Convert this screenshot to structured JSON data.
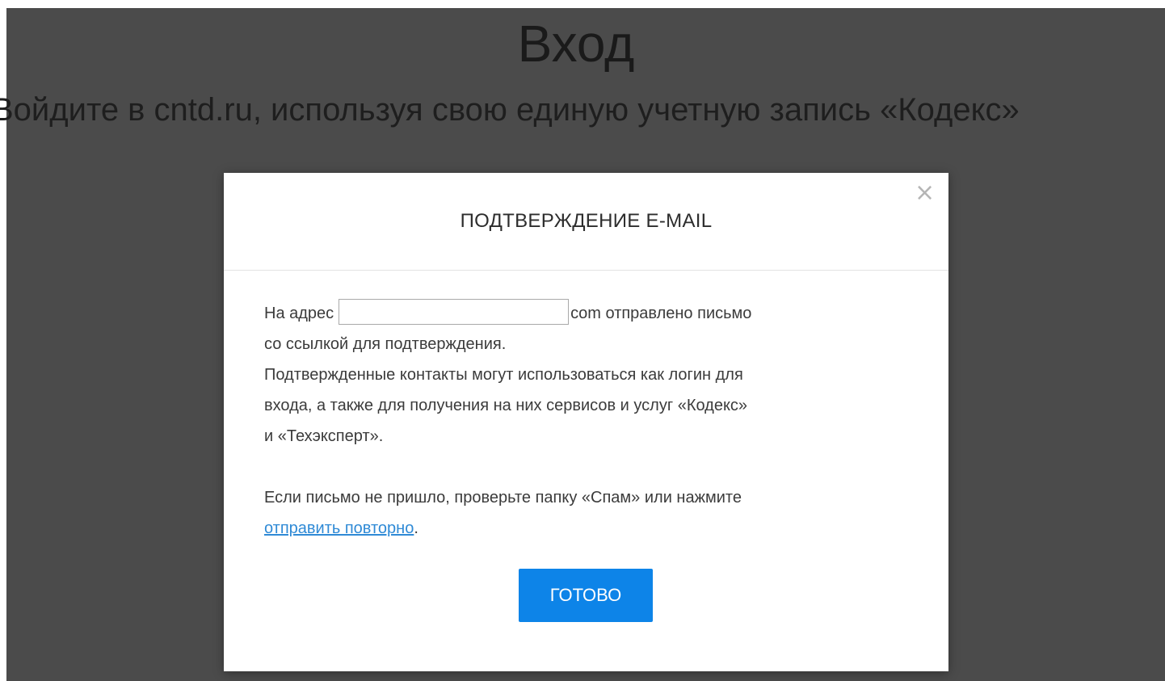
{
  "page": {
    "title": "Вход",
    "subtitle": "Войдите в cntd.ru, используя свою единую учетную запись «Кодекс»"
  },
  "modal": {
    "close_icon": "×",
    "title": "ПОДТВЕРЖДЕНИЕ E-MAIL",
    "line1_prefix": "На адрес",
    "email_value": "",
    "line1_suffix": "com отправлено письмо",
    "line2": "со ссылкой для подтверждения.",
    "line3": "Подтвержденные контакты могут использоваться как логин для",
    "line4": "входа, а также для получения на них сервисов и услуг «Кодекс»",
    "line5": "и «Техэксперт».",
    "line6": "Если письмо не пришло, проверьте папку «Спам» или нажмите",
    "resend_link": "отправить повторно",
    "resend_suffix": ".",
    "done_button": "ГОТОВО"
  },
  "colors": {
    "backdrop": "#4b4b4b",
    "accent": "#0d84e8",
    "link": "#2f8ad6"
  },
  "icons": {
    "close": "close-icon"
  }
}
